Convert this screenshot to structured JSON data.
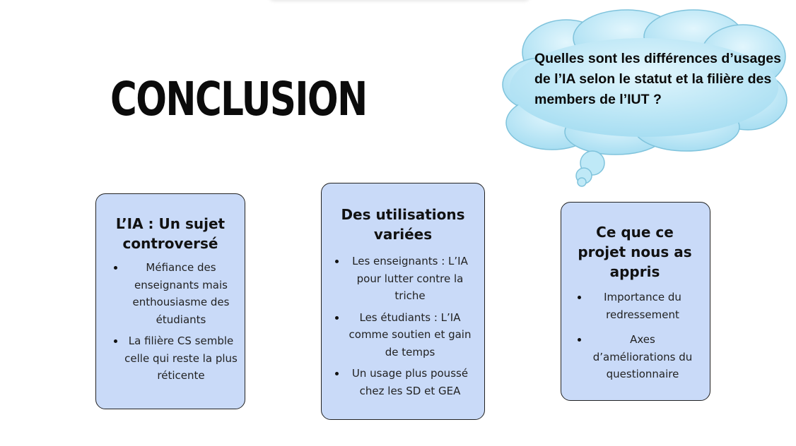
{
  "slide": {
    "title": "CONCLUSION"
  },
  "cloud": {
    "text": "Quelles sont les différences d’usages de l’IA selon le statut et la filière des members de l’IUT ?"
  },
  "cards": [
    {
      "title": "L’IA : Un sujet controversé",
      "bullets": [
        "Méfiance des enseignants mais enthousiasme des étudiants",
        "La filière CS semble celle qui reste la plus réticente"
      ]
    },
    {
      "title": "Des utilisations variées",
      "bullets": [
        "Les enseignants : L’IA pour lutter contre la triche",
        "Les étudiants : L’IA comme soutien et gain de temps",
        "Un usage plus poussé chez les SD et GEA"
      ]
    },
    {
      "title": "Ce que ce projet nous as appris",
      "bullets": [
        "Importance du redressement",
        "Axes d’améliorations du questionnaire"
      ]
    }
  ],
  "colors": {
    "card_fill": "#c9daf8",
    "cloud_fill": "#aee4f5",
    "card_border": "#222222"
  }
}
